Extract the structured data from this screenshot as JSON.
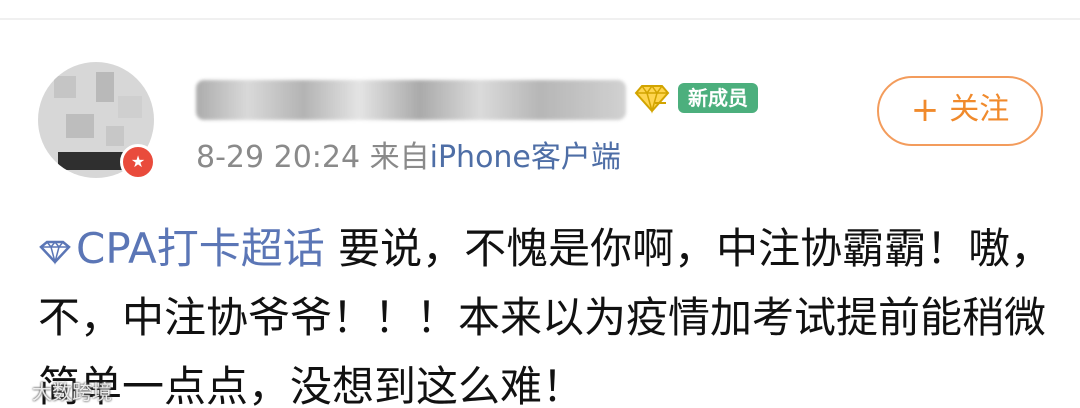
{
  "post": {
    "avatar_badge_icon": "star-icon",
    "author_badge_icon": "diamond-badge-icon",
    "member_badge": "新成员",
    "follow_plus": "+",
    "follow_label": "关注",
    "date_time": "8-29 20:24",
    "source_prefix": "来自",
    "device": "iPhone客户端",
    "topic_icon": "diamond-icon",
    "topic": "CPA打卡超话",
    "content_text": " 要说，不愧是你啊，中注协霸霸！嗷，不，中注协爷爷！！！本来以为疫情加考试提前能稍微简单一点点，没想到这么难！",
    "watermark": "大数跨境"
  },
  "colors": {
    "accent": "#f08a2c",
    "link": "#5b76b6",
    "member_badge": "#4caf7d",
    "meta_text": "#8a8a8a"
  }
}
